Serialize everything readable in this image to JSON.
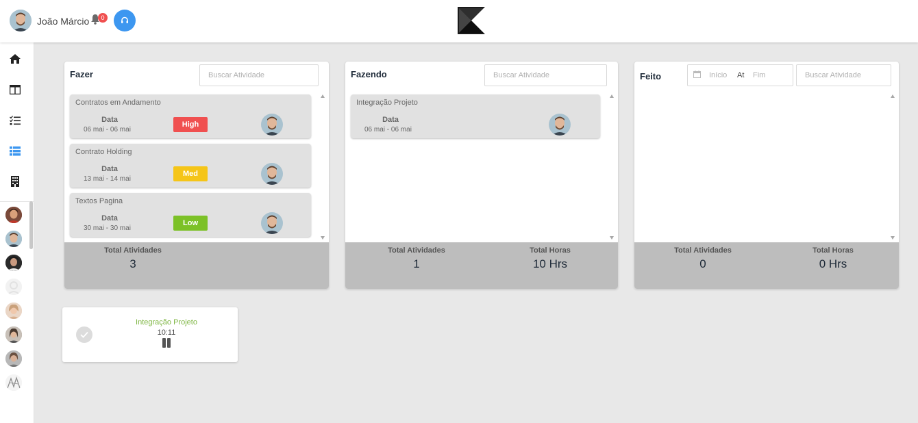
{
  "header": {
    "user_name": "João Márcio",
    "notification_count": "0",
    "icons": {
      "avatar": "user-avatar",
      "bell": "bell-icon",
      "support": "headset-icon",
      "logo": "brand-logo"
    }
  },
  "sidebar": {
    "nav_icons": [
      "home-icon",
      "board-icon",
      "checklist-icon",
      "list-icon",
      "building-icon"
    ],
    "active_nav": "list-icon",
    "accent_color": "#3d97f0"
  },
  "columns": {
    "todo": {
      "title": "Fazer",
      "search_placeholder": "Buscar Atividade",
      "cards": [
        {
          "title": "Contratos em Andamento",
          "data_label": "Data",
          "dates": "06 mai - 06 mai",
          "priority": "High",
          "priority_color": "#f05050"
        },
        {
          "title": "Contrato Holding",
          "data_label": "Data",
          "dates": "13 mai - 14 mai",
          "priority": "Med",
          "priority_color": "#f5c518"
        },
        {
          "title": "Textos Pagina",
          "data_label": "Data",
          "dates": "30 mai - 30 mai",
          "priority": "Low",
          "priority_color": "#7cc127"
        }
      ],
      "footer": {
        "total_activities_label": "Total Atividades",
        "total_activities": "3"
      }
    },
    "doing": {
      "title": "Fazendo",
      "search_placeholder": "Buscar Atividade",
      "cards": [
        {
          "title": "Integração Projeto",
          "data_label": "Data",
          "dates": "06 mai - 06 mai"
        }
      ],
      "footer": {
        "total_activities_label": "Total Atividades",
        "total_activities": "1",
        "total_hours_label": "Total Horas",
        "total_hours": "10 Hrs"
      }
    },
    "done": {
      "title": "Feito",
      "date_start_placeholder": "Início",
      "date_separator": "At",
      "date_end_placeholder": "Fim",
      "search_placeholder": "Buscar Atividade",
      "footer": {
        "total_activities_label": "Total Atividades",
        "total_activities": "0",
        "total_hours_label": "Total Horas",
        "total_hours": "0 Hrs"
      }
    }
  },
  "timer": {
    "task_name": "Integração Projeto",
    "elapsed": "10:11",
    "task_color": "#7db541"
  }
}
